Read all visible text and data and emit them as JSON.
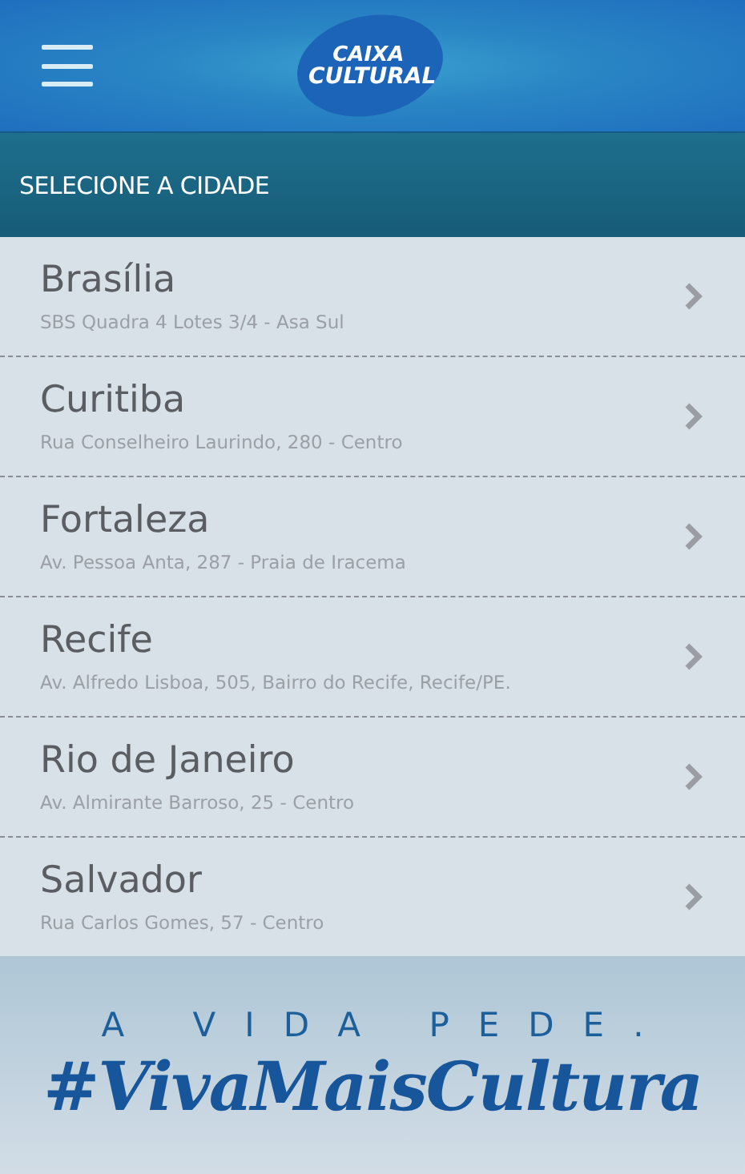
{
  "header": {
    "logo_lines": [
      "CAIXA",
      "CULTURAL"
    ]
  },
  "section_title": "SELECIONE A CIDADE",
  "cities": [
    {
      "name": "Brasília",
      "address": "SBS Quadra 4 Lotes 3/4 - Asa Sul"
    },
    {
      "name": "Curitiba",
      "address": "Rua Conselheiro Laurindo, 280 - Centro"
    },
    {
      "name": "Fortaleza",
      "address": "Av. Pessoa Anta, 287 - Praia de Iracema"
    },
    {
      "name": "Recife",
      "address": "Av. Alfredo Lisboa, 505, Bairro do Recife, Recife/PE."
    },
    {
      "name": "Rio de Janeiro",
      "address": "Av. Almirante Barroso, 25 - Centro"
    },
    {
      "name": "Salvador",
      "address": "Rua Carlos Gomes, 57 - Centro"
    }
  ],
  "banner": {
    "tagline": "A VIDA PEDE.",
    "hashtag": "#VivaMaisCultura"
  }
}
